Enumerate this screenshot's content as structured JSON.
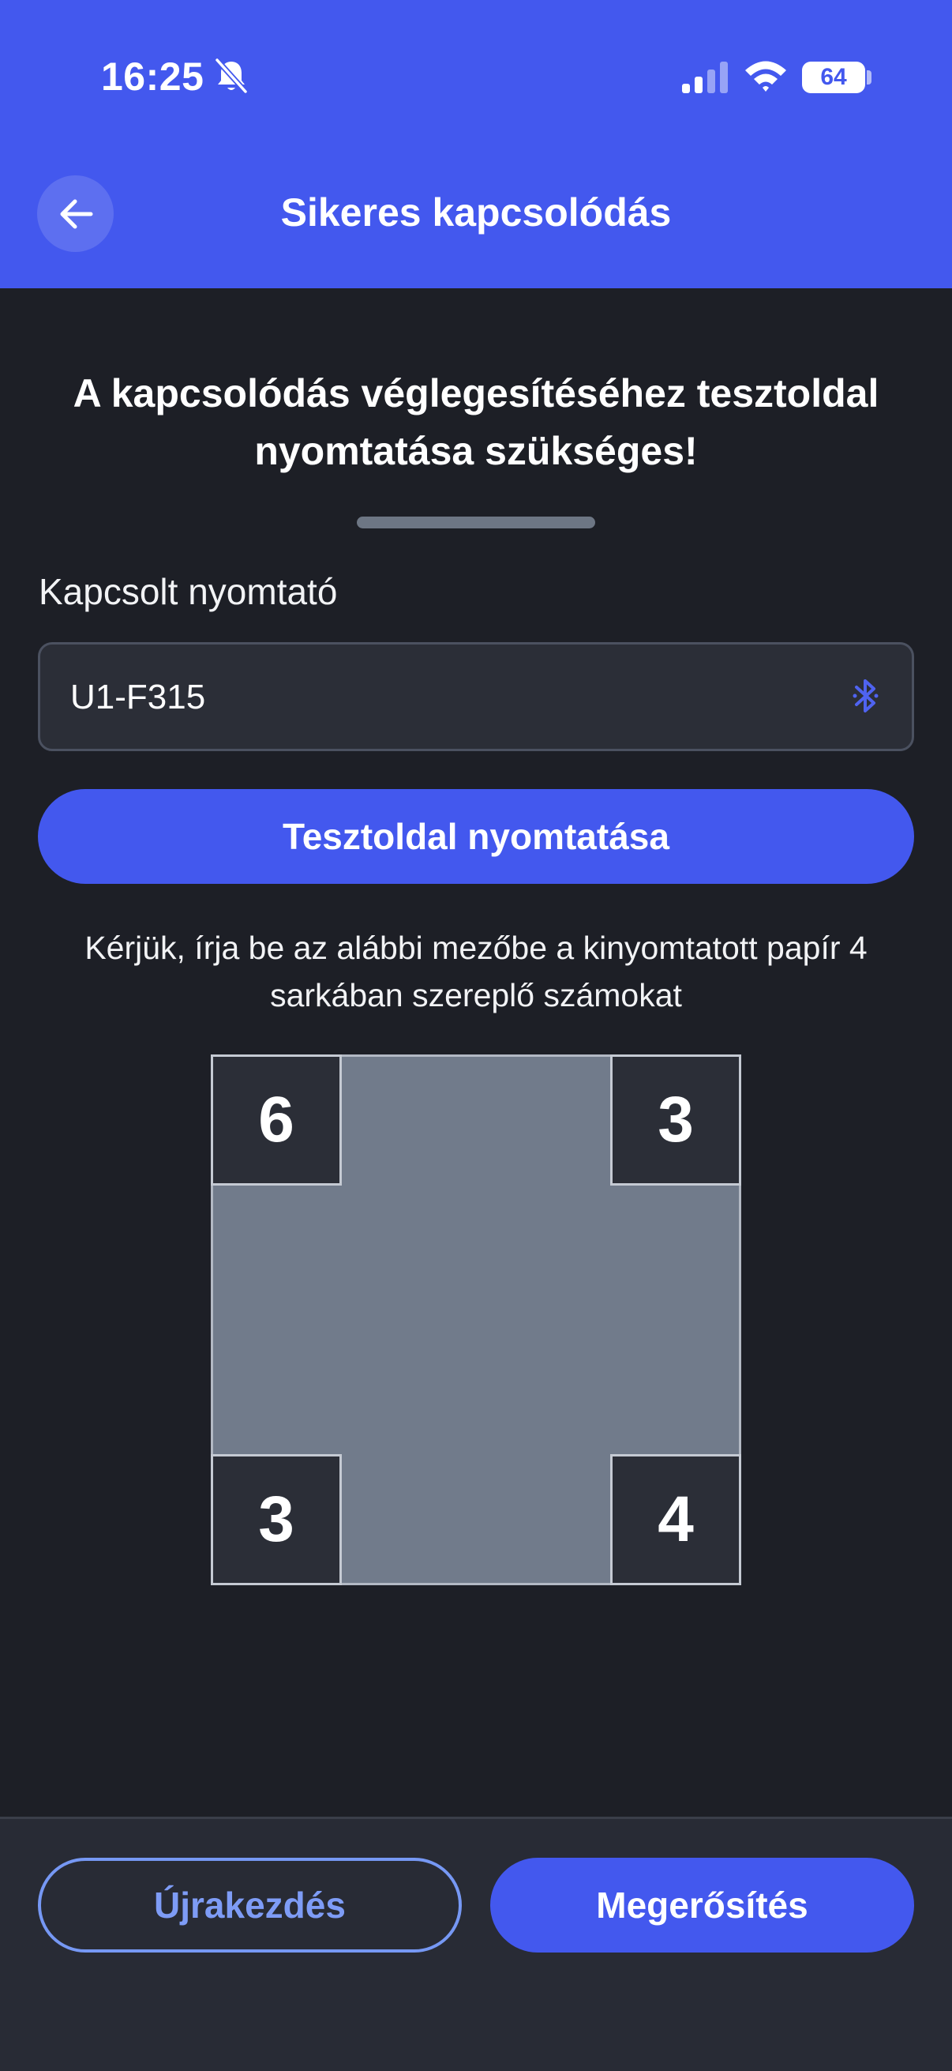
{
  "status_bar": {
    "time": "16:25",
    "battery": "64",
    "icons": [
      "bell-slash-icon",
      "signal-icon",
      "wifi-icon",
      "battery-icon"
    ]
  },
  "header": {
    "back_icon": "arrow-left-icon",
    "title": "Sikeres kapcsolódás"
  },
  "main": {
    "headline": "A kapcsolódás véglegesítéséhez tesztoldal nyomtatása szükséges!",
    "printer_label": "Kapcsolt nyomtató",
    "printer_value": "U1-F315",
    "printer_icon": "bluetooth-icon",
    "print_button": "Tesztoldal nyomtatása",
    "instruction": "Kérjük, írja be az alábbi mezőbe a kinyomtatott papír 4 sarkában szereplő számokat",
    "corners": {
      "top_left": "6",
      "top_right": "3",
      "bottom_left": "3",
      "bottom_right": "4"
    }
  },
  "footer": {
    "restart_button": "Újrakezdés",
    "confirm_button": "Megerősítés"
  },
  "colors": {
    "accent": "#4358ee",
    "background": "#1d1f26",
    "surface": "#2b2e37",
    "outline_button": "#7e9cf6",
    "code_box": "#717b8b"
  }
}
